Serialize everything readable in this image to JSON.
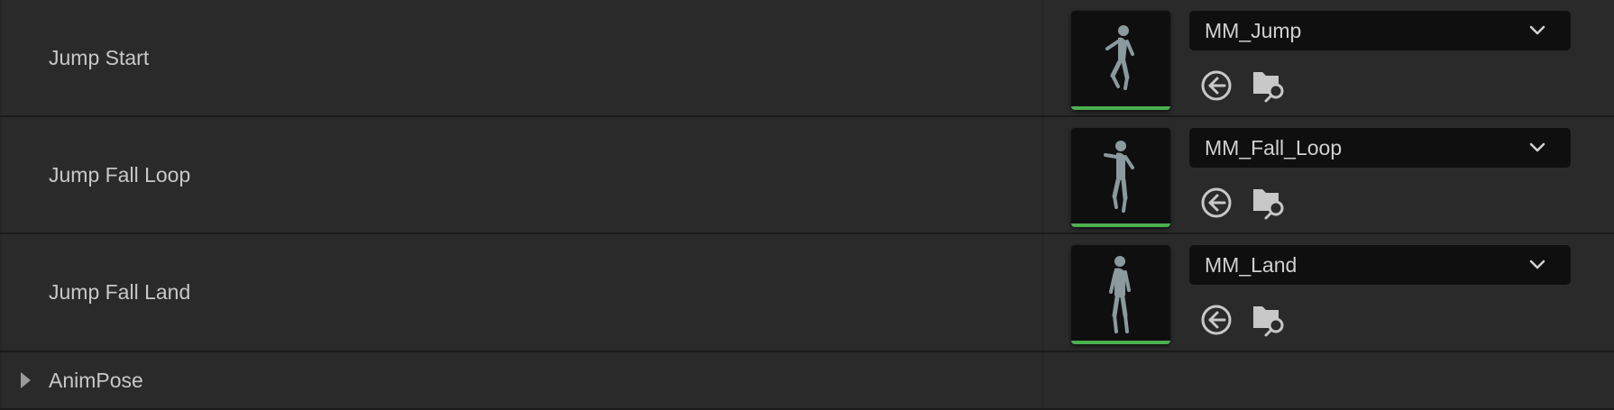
{
  "rows": [
    {
      "label": "Jump Start",
      "asset": "MM_Jump"
    },
    {
      "label": "Jump Fall Loop",
      "asset": "MM_Fall_Loop"
    },
    {
      "label": "Jump Fall Land",
      "asset": "MM_Land"
    }
  ],
  "group": {
    "label": "AnimPose"
  },
  "icons": {
    "combo": "chevron-down-icon",
    "use": "use-selected-arrow-icon",
    "browse": "browse-folder-search-icon",
    "expand": "expand-arrow-icon"
  },
  "colors": {
    "background": "#2a2a2a",
    "divider": "#1a1a1a",
    "thumbnail_bar": "#4caf50",
    "combo_bg": "#0f0f0f"
  }
}
